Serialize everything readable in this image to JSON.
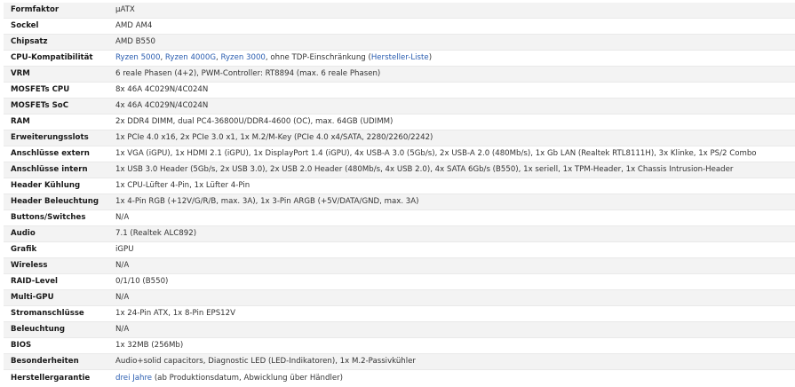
{
  "colors": {
    "link": "#2a5db0",
    "row_alt": "#f3f3f3",
    "border": "#e9e9e9"
  },
  "rows": [
    {
      "label": "Formfaktor",
      "value": "µATX"
    },
    {
      "label": "Sockel",
      "value": "AMD AM4"
    },
    {
      "label": "Chipsatz",
      "value": "AMD B550"
    },
    {
      "label": "CPU-Kompatibilität",
      "link1": "Ryzen 5000",
      "sep1": ", ",
      "link2": "Ryzen 4000G",
      "sep2": ", ",
      "link3": "Ryzen 3000",
      "sep3": ", ohne TDP-Einschränkung (",
      "link4": "Hersteller-Liste",
      "sep4": ")"
    },
    {
      "label": "VRM",
      "value": "6 reale Phasen (4+2), PWM-Controller: RT8894 (max. 6 reale Phasen)"
    },
    {
      "label": "MOSFETs CPU",
      "value": "8x 46A 4C029N/4C024N"
    },
    {
      "label": "MOSFETs SoC",
      "value": "4x 46A 4C029N/4C024N"
    },
    {
      "label": "RAM",
      "value": "2x DDR4 DIMM, dual PC4-36800U/DDR4-4600 (OC), max. 64GB (UDIMM)"
    },
    {
      "label": "Erweiterungsslots",
      "value": "1x PCIe 4.0 x16, 2x PCIe 3.0 x1, 1x M.2/M-Key (PCIe 4.0 x4/SATA, 2280/2260/2242)"
    },
    {
      "label": "Anschlüsse extern",
      "value": "1x VGA (iGPU), 1x HDMI 2.1 (iGPU), 1x DisplayPort 1.4 (iGPU), 4x USB-A 3.0 (5Gb/s), 2x USB-A 2.0 (480Mb/s), 1x Gb LAN (Realtek RTL8111H), 3x Klinke, 1x PS/2 Combo"
    },
    {
      "label": "Anschlüsse intern",
      "value": "1x USB 3.0 Header (5Gb/s, 2x USB 3.0), 2x USB 2.0 Header (480Mb/s, 4x USB 2.0), 4x SATA 6Gb/s (B550), 1x seriell, 1x TPM-Header, 1x Chassis Intrusion-Header"
    },
    {
      "label": "Header Kühlung",
      "value": "1x CPU-Lüfter 4-Pin, 1x Lüfter 4-Pin"
    },
    {
      "label": "Header Beleuchtung",
      "value": "1x 4-Pin RGB (+12V/G/R/B, max. 3A), 1x 3-Pin ARGB (+5V/DATA/GND, max. 3A)"
    },
    {
      "label": "Buttons/Switches",
      "value": "N/A"
    },
    {
      "label": "Audio",
      "value": "7.1 (Realtek ALC892)"
    },
    {
      "label": "Grafik",
      "value": "iGPU"
    },
    {
      "label": "Wireless",
      "value": "N/A"
    },
    {
      "label": "RAID-Level",
      "value": "0/1/10 (B550)"
    },
    {
      "label": "Multi-GPU",
      "value": "N/A"
    },
    {
      "label": "Stromanschlüsse",
      "value": "1x 24-Pin ATX, 1x 8-Pin EPS12V"
    },
    {
      "label": "Beleuchtung",
      "value": "N/A"
    },
    {
      "label": "BIOS",
      "value": "1x 32MB (256Mb)"
    },
    {
      "label": "Besonderheiten",
      "value": "Audio+solid capacitors, Diagnostic LED (LED-Indikatoren), 1x M.2-Passivkühler"
    },
    {
      "label": "Herstellergarantie",
      "link1": "drei Jahre",
      "sep1": " (ab Produktionsdatum, Abwicklung über Händler)"
    }
  ]
}
